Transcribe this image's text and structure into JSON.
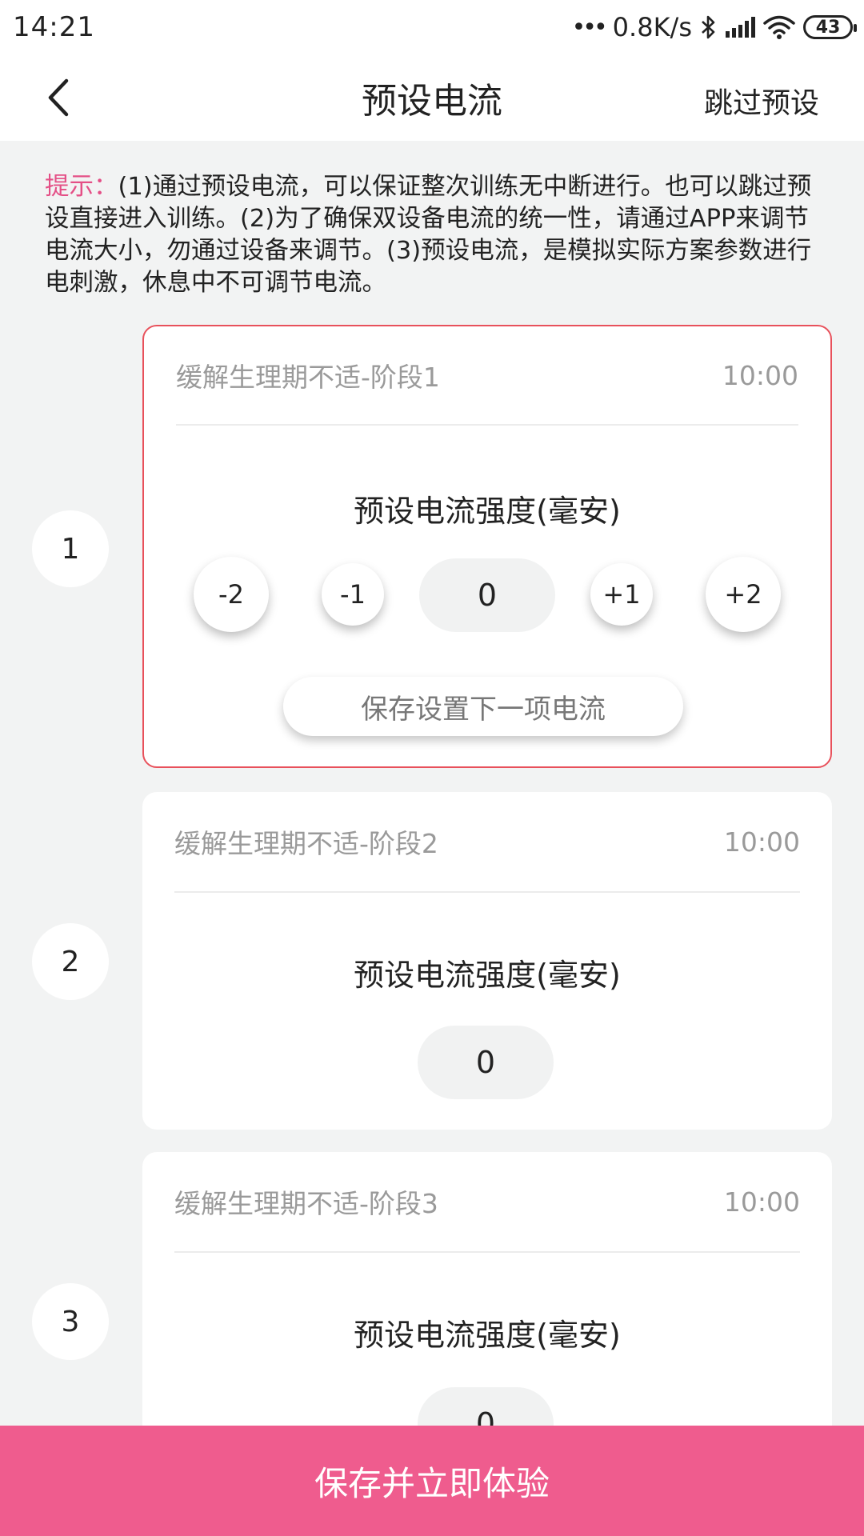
{
  "status_bar": {
    "time": "14:21",
    "network_speed": "0.8K/s",
    "battery": "43",
    "icons": [
      "dots-icon",
      "bluetooth-icon",
      "signal-icon",
      "wifi-icon",
      "battery-icon"
    ]
  },
  "header": {
    "title": "预设电流",
    "skip_label": "跳过预设",
    "back_icon": "chevron-left-icon"
  },
  "hint": {
    "label": "提示：",
    "text": "(1)通过预设电流，可以保证整次训练无中断进行。也可以跳过预设直接进入训练。(2)为了确保双设备电流的统一性，请通过APP来调节电流大小，勿通过设备来调节。(3)预设电流，是模拟实际方案参数进行电刺激，休息中不可调节电流。",
    "label_color": "#e44f86"
  },
  "stages": [
    {
      "index": "1",
      "name": "缓解生理期不适-阶段1",
      "duration": "10:00",
      "subtitle": "预设电流强度(毫安)",
      "value": "0",
      "active": true,
      "buttons": [
        "-2",
        "-1",
        "+1",
        "+2"
      ],
      "save_next_label": "保存设置下一项电流"
    },
    {
      "index": "2",
      "name": "缓解生理期不适-阶段2",
      "duration": "10:00",
      "subtitle": "预设电流强度(毫安)",
      "value": "0",
      "active": false
    },
    {
      "index": "3",
      "name": "缓解生理期不适-阶段3",
      "duration": "10:00",
      "subtitle": "预设电流强度(毫安)",
      "value": "0",
      "active": false
    }
  ],
  "bottom_button": {
    "label": "保存并立即体验",
    "color": "#ef5c8e"
  },
  "colors": {
    "accent": "#ef5c8e",
    "active_border": "#e8515b",
    "background": "#f2f3f3"
  }
}
